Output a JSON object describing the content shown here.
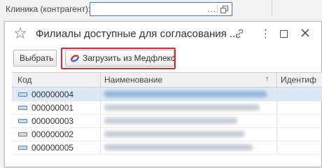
{
  "parent": {
    "field_label": "Клиника (контрагент):",
    "field_value": "",
    "ellipsis_label": "..."
  },
  "dialog": {
    "title": "Филиалы доступные для согласования ...",
    "menu_label": "⋮"
  },
  "toolbar": {
    "select_label": "Выбрать",
    "load_label": "Загрузить из Медфлекс"
  },
  "table": {
    "columns": [
      "Код",
      "Наименование",
      "Идентиф"
    ],
    "sort_indicator": "↑",
    "rows": [
      {
        "code": "000000004",
        "selected": true
      },
      {
        "code": "000000001",
        "selected": false
      },
      {
        "code": "000000003",
        "selected": false
      },
      {
        "code": "000000002",
        "selected": false
      },
      {
        "code": "000000005",
        "selected": false
      }
    ]
  },
  "colors": {
    "accent": "#3a7bd5",
    "highlight": "#e0282a",
    "selected_row": "#dbe8f6"
  },
  "icons": [
    "copy-icon",
    "star-icon",
    "link-icon",
    "more-vertical-icon",
    "maximize-icon",
    "close-icon",
    "medflex-icon",
    "row-marker-icon"
  ]
}
